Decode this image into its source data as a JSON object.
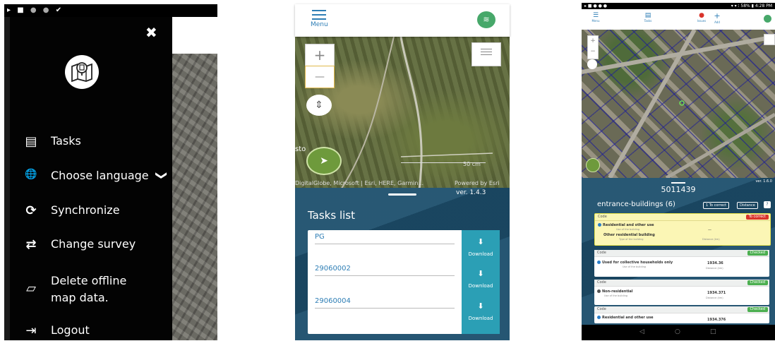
{
  "panel1": {
    "status_icons": [
      "▸",
      "■",
      "●",
      "●",
      "✔"
    ],
    "close_icon": "✖",
    "menu": [
      {
        "label": "Tasks",
        "icon": "▤"
      },
      {
        "label": "Choose language",
        "icon": "🌐"
      },
      {
        "label": "Synchronize",
        "icon": "⟳"
      },
      {
        "label": "Change survey",
        "icon": "⇄"
      },
      {
        "label": "Delete offline map data.",
        "icon": "▱"
      },
      {
        "label": "Logout",
        "icon": "⇥"
      }
    ],
    "chevron": "❯"
  },
  "panel2": {
    "menu_label": "Menu",
    "zoom_in": "+",
    "zoom_out": "—",
    "map_label_left": "sto",
    "scale_label": "50 cm",
    "attribution": "DigitalGlobe, Microsoft | Esri, HERE, Garmin...",
    "powered": "Powered by Esri",
    "version": "ver. 1.4.3",
    "tasks_title": "Tasks list",
    "tasks": [
      {
        "code": "PG",
        "download": "Download"
      },
      {
        "code": "29060002",
        "download": "Download"
      },
      {
        "code": "29060004",
        "download": "Download"
      }
    ]
  },
  "panel3": {
    "nav": [
      {
        "label": "Menu"
      },
      {
        "label": "Tasks"
      },
      {
        "label": "Issues"
      },
      {
        "label": "Add"
      }
    ],
    "status_right": "▾ ▾ ⁝ 58% ▮ 4:28 PM",
    "version": "ver. 1.6.0",
    "parcel_id": "5011439",
    "layer_title": "entrance-buildings (6)",
    "btn_to_correct": "1 To correct",
    "btn_distance": "Distance",
    "btn_help": "?",
    "buildings": [
      {
        "code": "Code",
        "badge": "To correct",
        "use": "Residential and other use",
        "use_sub": "Use of the building",
        "type": "Other residential building",
        "type_sub": "Type of the building",
        "value": "—",
        "value_sub": "Distance (km)",
        "dot": "#2b7ec9"
      },
      {
        "code": "Code",
        "badge": "Checked",
        "use": "Used for collective households only",
        "use_sub": "Use of the building",
        "value": "1934.36",
        "value_sub": "Distance (km)",
        "dot": "#2b7ec9"
      },
      {
        "code": "Code",
        "badge": "Checked",
        "use": "Non-residential",
        "use_sub": "Use of the building",
        "value": "1934.371",
        "value_sub": "Distance (km)",
        "dot": "#555"
      },
      {
        "code": "Code",
        "badge": "Checked",
        "use": "Residential and other use",
        "use_sub": "",
        "value": "1934.376",
        "value_sub": "",
        "dot": "#2b7ec9"
      }
    ],
    "android_nav": [
      "◁",
      "○",
      "□"
    ],
    "colors": {
      "to_correct": "#d9342b",
      "checked": "#4caf50",
      "highlight": "#fbf6b5",
      "highlight_border": "#e9e34a"
    }
  }
}
